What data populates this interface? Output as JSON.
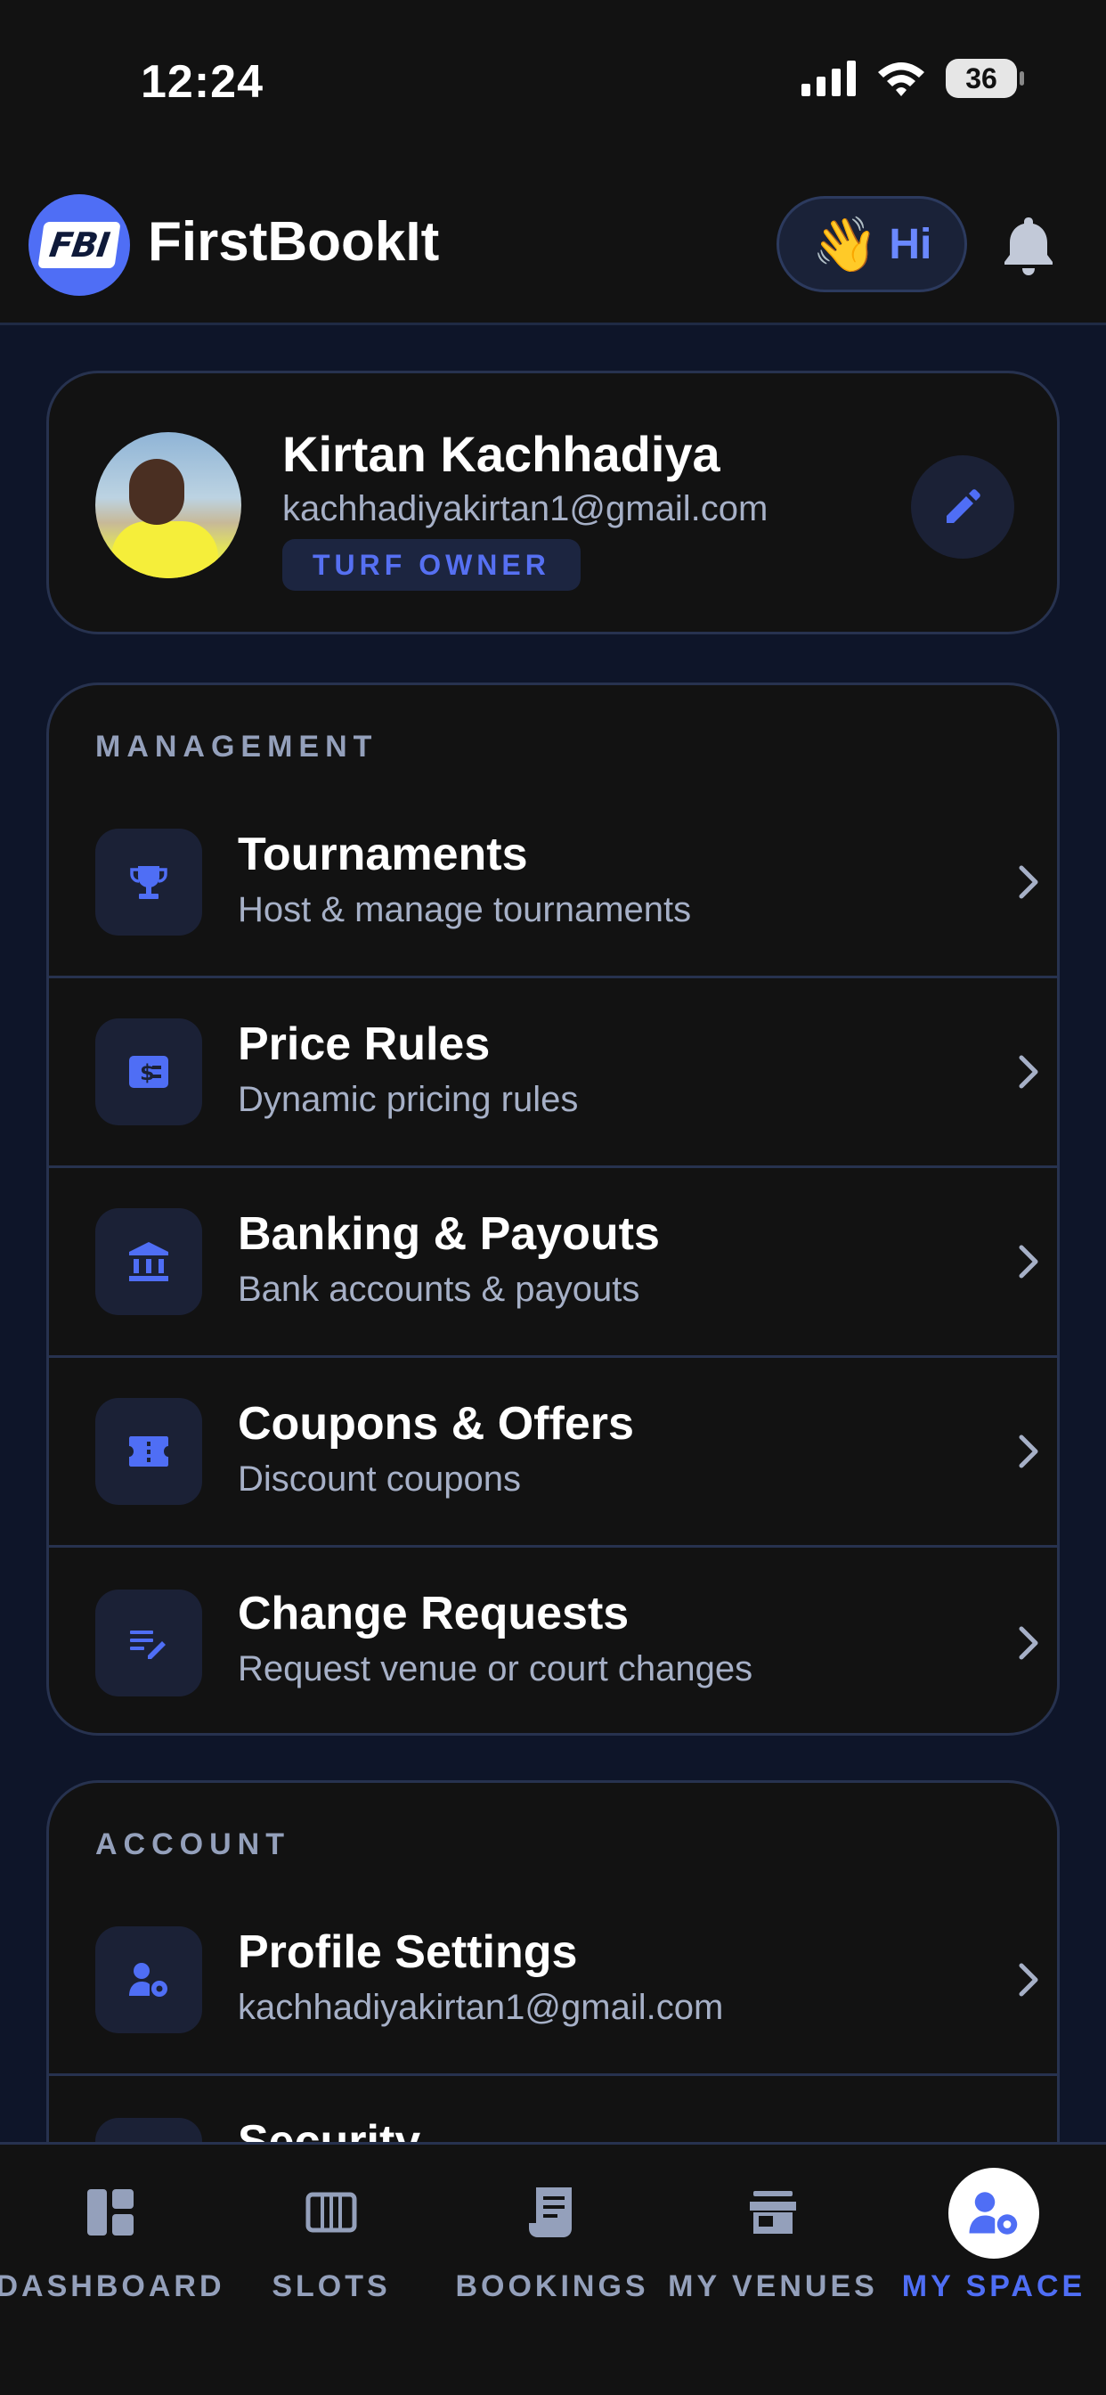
{
  "status_bar": {
    "time": "12:24",
    "battery": "36"
  },
  "header": {
    "logo_text": "FBI",
    "app_title": "FirstBookIt",
    "greeting_emoji": "👋",
    "greeting": "Hi"
  },
  "profile": {
    "name": "Kirtan Kachhadiya",
    "email": "kachhadiyakirtan1@gmail.com",
    "role": "TURF OWNER"
  },
  "management": {
    "title": "MANAGEMENT",
    "items": [
      {
        "title": "Tournaments",
        "subtitle": "Host & manage tournaments",
        "icon": "trophy-icon"
      },
      {
        "title": "Price Rules",
        "subtitle": "Dynamic pricing rules",
        "icon": "price-tag-icon"
      },
      {
        "title": "Banking & Payouts",
        "subtitle": "Bank accounts & payouts",
        "icon": "bank-icon"
      },
      {
        "title": "Coupons & Offers",
        "subtitle": "Discount coupons",
        "icon": "coupon-icon"
      },
      {
        "title": "Change Requests",
        "subtitle": "Request venue or court changes",
        "icon": "edit-note-icon"
      }
    ]
  },
  "account": {
    "title": "ACCOUNT",
    "items": [
      {
        "title": "Profile Settings",
        "subtitle": "kachhadiyakirtan1@gmail.com",
        "icon": "user-settings-icon"
      },
      {
        "title": "Security",
        "subtitle": "",
        "icon": "lock-icon"
      }
    ]
  },
  "bottom_nav": {
    "items": [
      {
        "label": "DASHBOARD",
        "icon": "dashboard-icon",
        "active": false
      },
      {
        "label": "SLOTS",
        "icon": "slots-icon",
        "active": false
      },
      {
        "label": "BOOKINGS",
        "icon": "bookings-icon",
        "active": false
      },
      {
        "label": "MY VENUES",
        "icon": "store-icon",
        "active": false
      },
      {
        "label": "MY SPACE",
        "icon": "user-settings-icon",
        "active": true
      }
    ]
  },
  "colors": {
    "accent": "#4f6ef5",
    "background": "#0e1529",
    "surface": "#121212",
    "muted_text": "#a6b0c7"
  }
}
